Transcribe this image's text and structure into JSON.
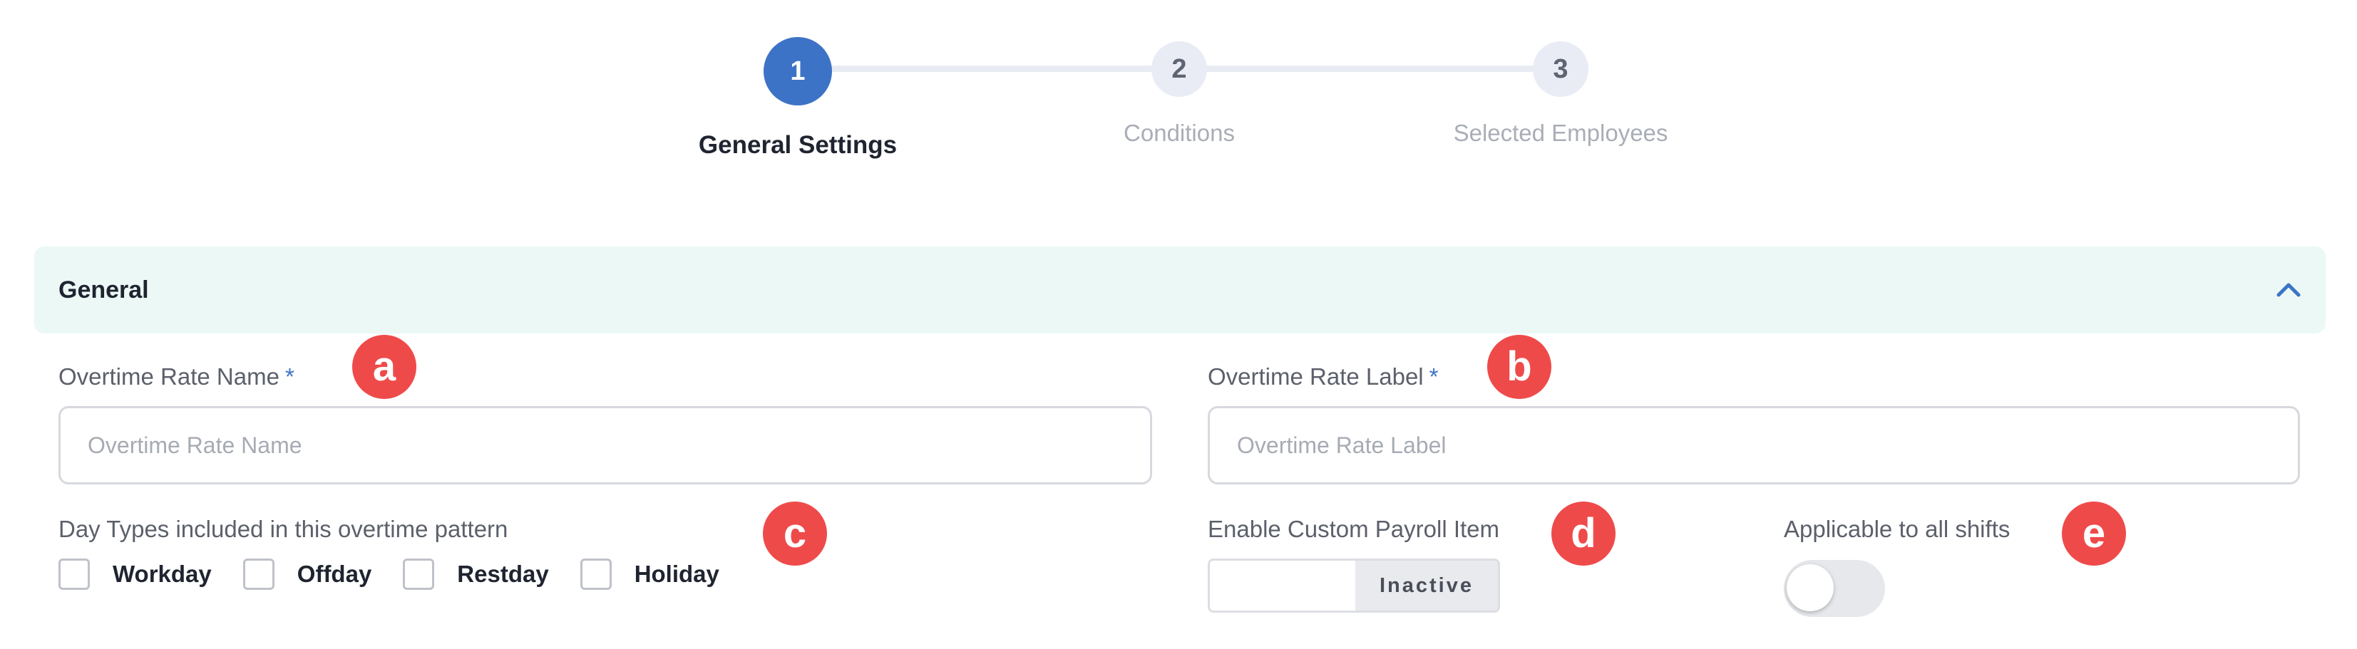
{
  "stepper": {
    "steps": [
      {
        "number": "1",
        "label": "General Settings",
        "state": "active"
      },
      {
        "number": "2",
        "label": "Conditions",
        "state": "pending"
      },
      {
        "number": "3",
        "label": "Selected Employees",
        "state": "pending"
      }
    ]
  },
  "section": {
    "title": "General",
    "collapse_icon": "chevron-up-icon"
  },
  "fields": {
    "rate_name": {
      "label": "Overtime Rate Name",
      "required_mark": "*",
      "placeholder": "Overtime Rate Name",
      "value": ""
    },
    "rate_label": {
      "label": "Overtime Rate Label",
      "required_mark": "*",
      "placeholder": "Overtime Rate Label",
      "value": ""
    },
    "day_types": {
      "label": "Day Types included in this overtime pattern",
      "options": [
        {
          "label": "Workday",
          "checked": false
        },
        {
          "label": "Offday",
          "checked": false
        },
        {
          "label": "Restday",
          "checked": false
        },
        {
          "label": "Holiday",
          "checked": false
        }
      ]
    },
    "custom_payroll": {
      "label": "Enable Custom Payroll Item",
      "state_text": "Inactive"
    },
    "all_shifts": {
      "label": "Applicable to all shifts",
      "on": false
    }
  },
  "annotations": [
    "a",
    "b",
    "c",
    "d",
    "e"
  ],
  "colors": {
    "primary": "#3d73c6",
    "section_bg": "#ebf8f6",
    "badge": "#ef4a4a"
  }
}
